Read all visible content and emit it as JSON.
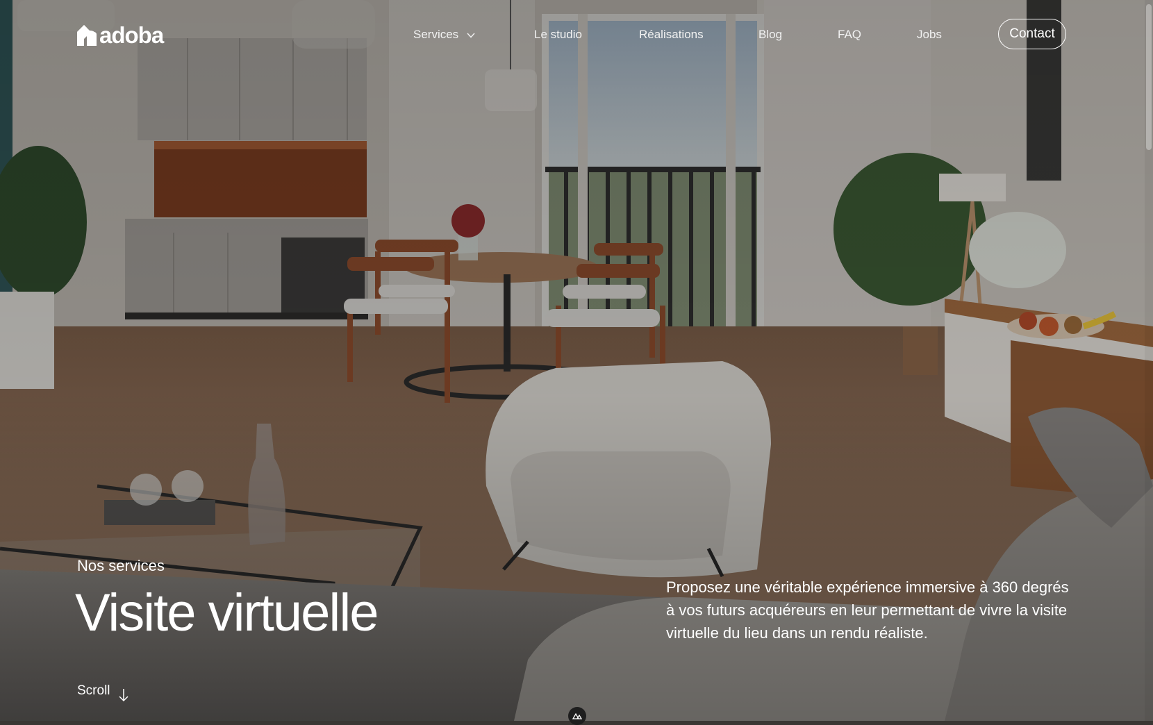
{
  "brand": {
    "name": "adoba"
  },
  "nav": {
    "items": [
      {
        "label": "Services",
        "has_dropdown": true
      },
      {
        "label": "Le studio"
      },
      {
        "label": "Réalisations"
      },
      {
        "label": "Blog"
      },
      {
        "label": "FAQ"
      },
      {
        "label": "Jobs"
      }
    ],
    "contact_label": "Contact"
  },
  "hero": {
    "eyebrow": "Nos services",
    "title": "Visite virtuelle",
    "description": "Proposez une véritable expérience immersive à 360 degrés à vos futurs acquéreurs en leur permettant de vivre la visite virtuelle du lieu dans un rendu réaliste.",
    "scroll_label": "Scroll"
  },
  "icons": {
    "dropdown": "chevron-down-icon",
    "scroll": "arrow-down-icon",
    "badge": "nuxt-logo-icon"
  },
  "colors": {
    "text": "#ffffff",
    "floor": "#8a6a52",
    "wood": "#8b4b2c"
  }
}
